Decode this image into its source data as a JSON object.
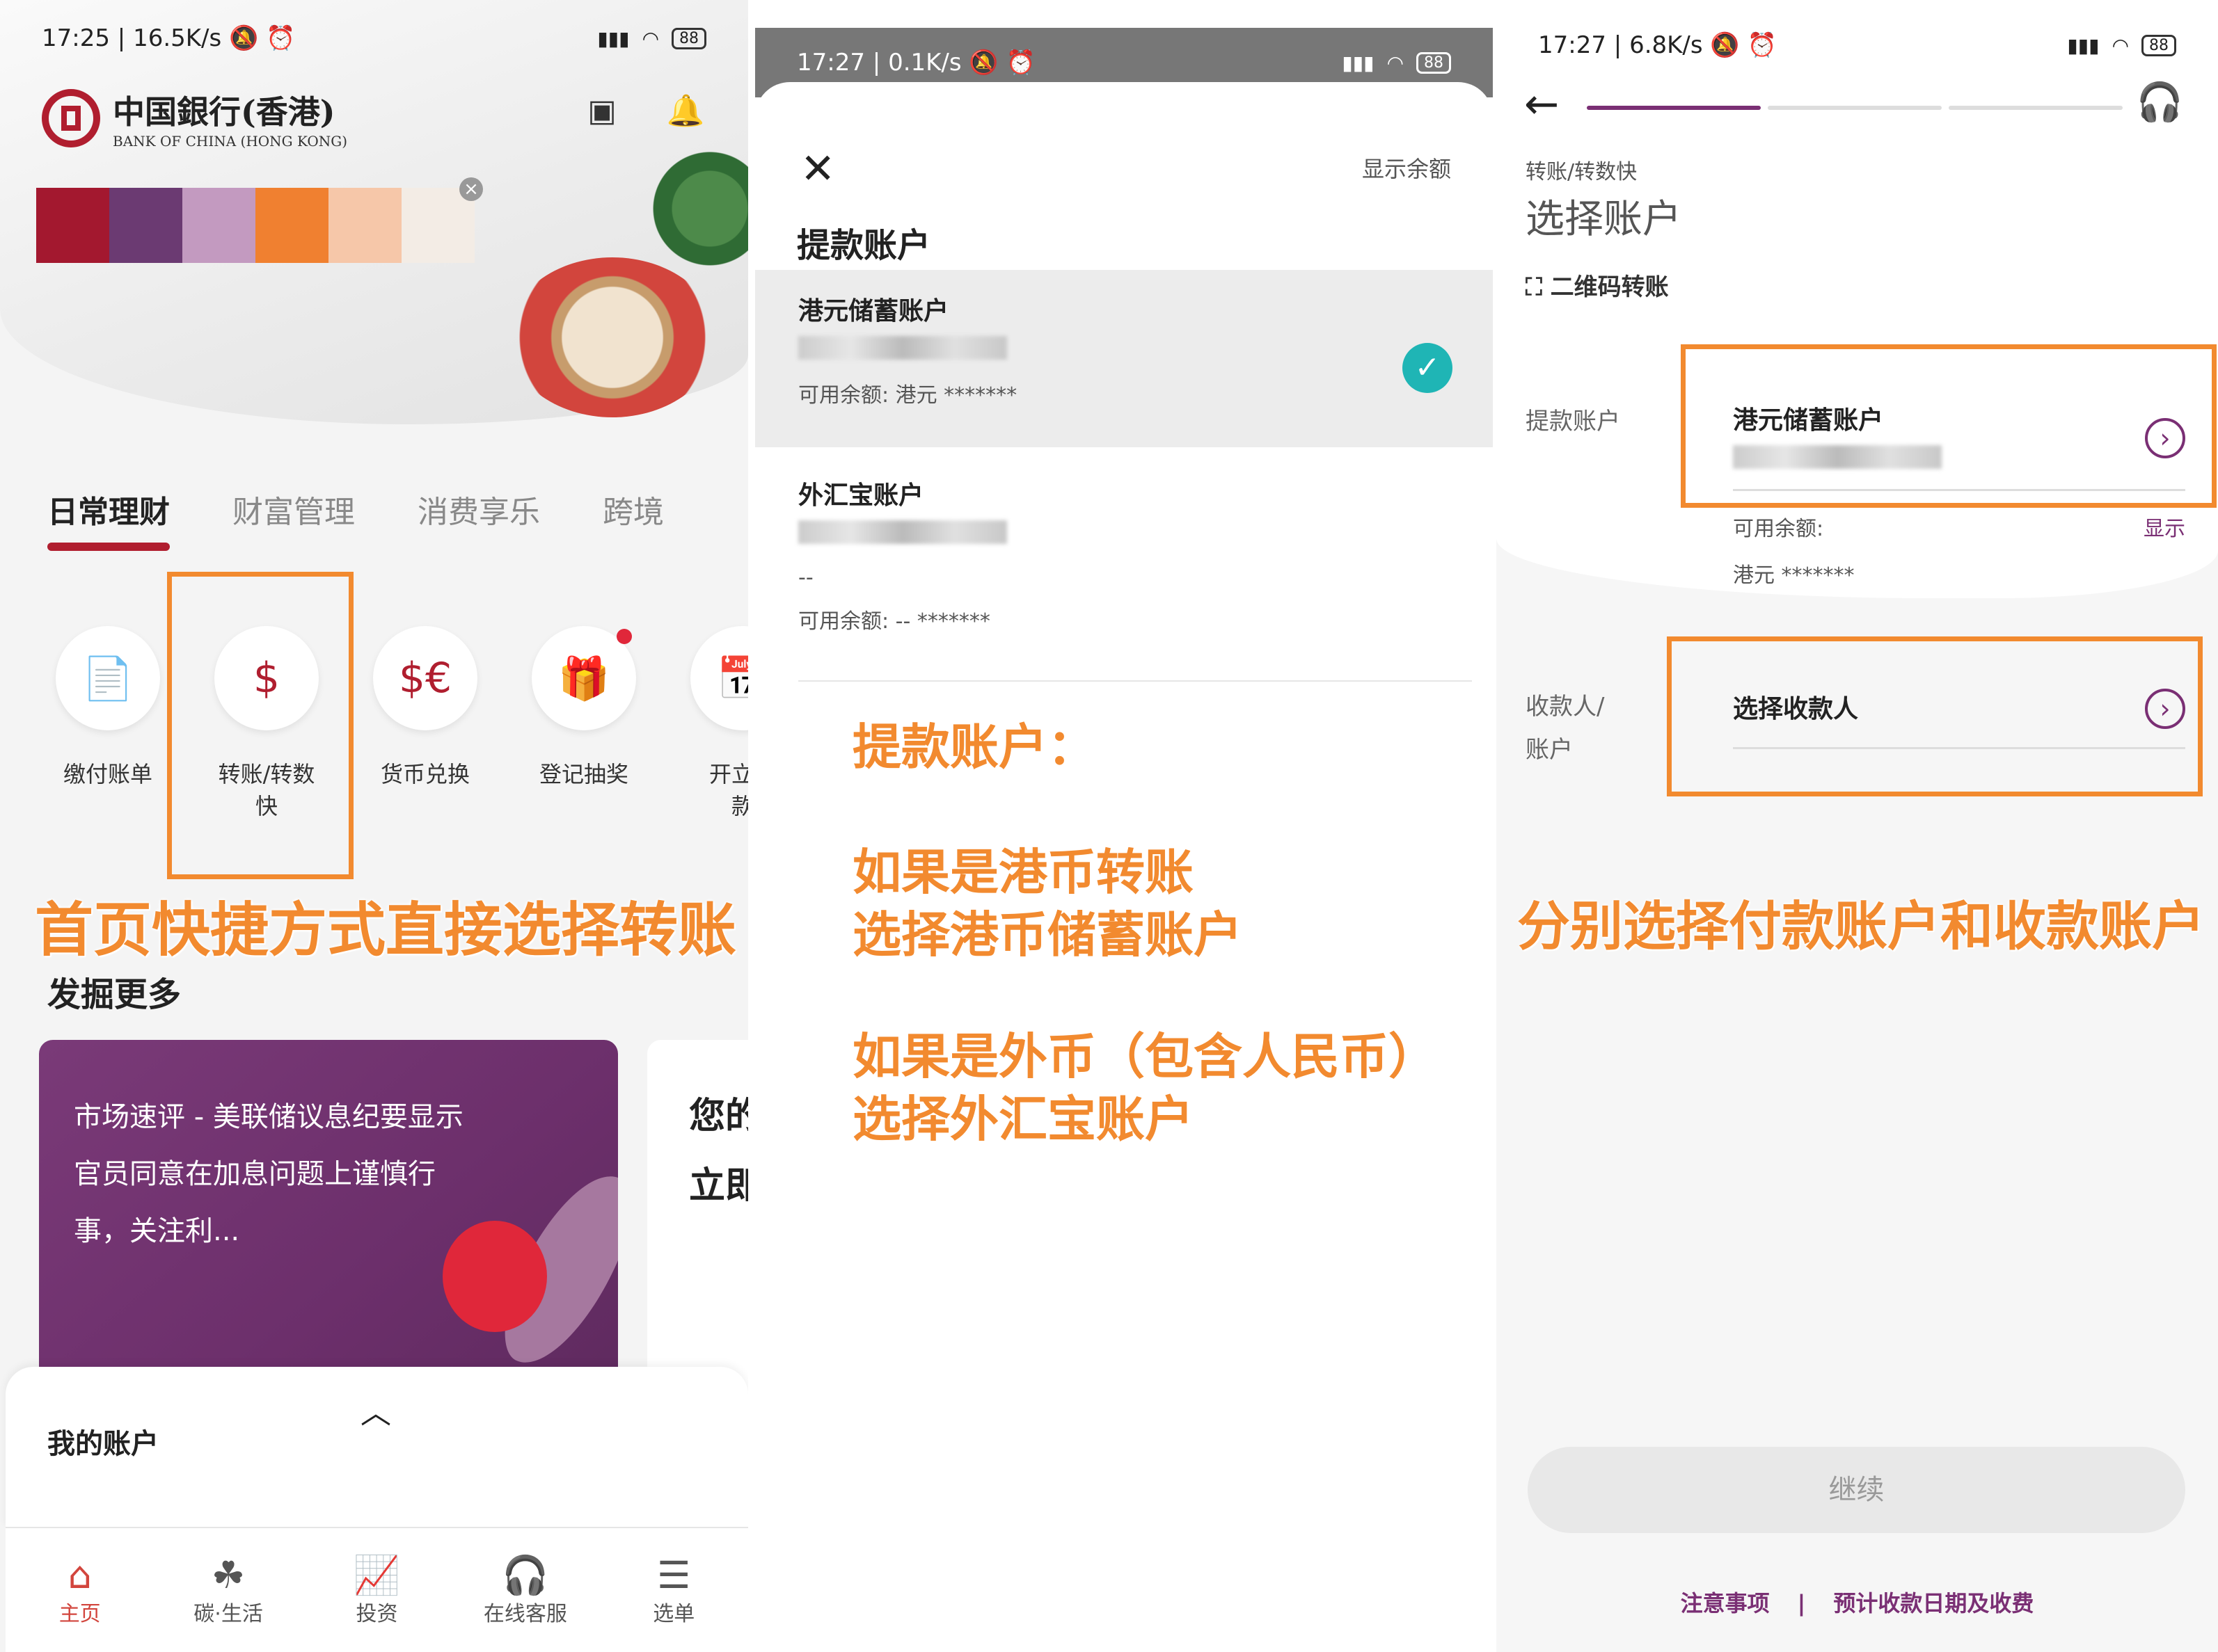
{
  "panel1": {
    "status": {
      "time": "17:25",
      "speed": "16.5K/s",
      "signal": "HD",
      "battery": "88"
    },
    "logo": {
      "cn": "中国銀行(香港)",
      "en": "BANK OF CHINA (HONG KONG)"
    },
    "icons": {
      "calculator": "calculator-icon",
      "bell": "bell-icon"
    },
    "swatch_colors": [
      "#a3182f",
      "#6b3a72",
      "#c39ac0",
      "#f08030",
      "#f6c7a9",
      "#f3ece5"
    ],
    "tabs": [
      "日常理财",
      "财富管理",
      "消费享乐",
      "跨境"
    ],
    "quick_actions": [
      "缴付账单",
      "转账/转数\n快",
      "货币兑换",
      "登记抽奖",
      "开立定\n款"
    ],
    "quick_icons": [
      "bill-icon",
      "transfer-icon",
      "exchange-icon",
      "gift-icon",
      "deposit-icon"
    ],
    "annotation": "首页快捷方式直接选择转账",
    "discover_title": "发掘更多",
    "promo_text": "市场速评 - 美联储议息纪要显示官员同意在加息问题上谨慎行事，关注利...",
    "card_partial": [
      "您的",
      "立即"
    ],
    "my_accounts": "我的账户",
    "nav": [
      "主页",
      "碳·生活",
      "投资",
      "在线客服",
      "选单"
    ],
    "nav_icons": [
      "home-icon",
      "leaf-icon",
      "chart-icon",
      "headset-icon",
      "menu-icon"
    ],
    "accent": "#b01e2f"
  },
  "panel2": {
    "status": {
      "time": "17:27",
      "speed": "0.1K/s",
      "battery": "88"
    },
    "show_balance": "显示余额",
    "title": "提款账户",
    "accounts": [
      {
        "name": "港元储蓄账户",
        "balance": "可用余额: 港元 *******",
        "selected": true
      },
      {
        "name": "外汇宝账户",
        "extra": "--",
        "balance": "可用余额: -- *******",
        "selected": false
      }
    ],
    "annotation_lines": [
      "提款账户：",
      "如果是港币转账",
      "选择港币储蓄账户",
      "如果是外币（包含人民币）",
      "选择外汇宝账户"
    ],
    "check_color": "#1fb5b5"
  },
  "panel3": {
    "status": {
      "time": "17:27",
      "speed": "6.8K/s",
      "battery": "88"
    },
    "breadcrumb": "转账/转数快",
    "title": "选择账户",
    "qr": "二维码转账",
    "from_label": "提款账户",
    "from_account": "港元储蓄账户",
    "available_label": "可用余额:",
    "show": "显示",
    "currency_masked": "港元 *******",
    "to_label": "收款人/\n账户",
    "to_placeholder": "选择收款人",
    "annotation": "分别选择付款账户和收款账户",
    "continue": "继续",
    "footer_links": [
      "注意事项",
      "|",
      "预计收款日期及收费"
    ],
    "accent": "#7a2f74",
    "annotation_color": "#f28a2f"
  }
}
